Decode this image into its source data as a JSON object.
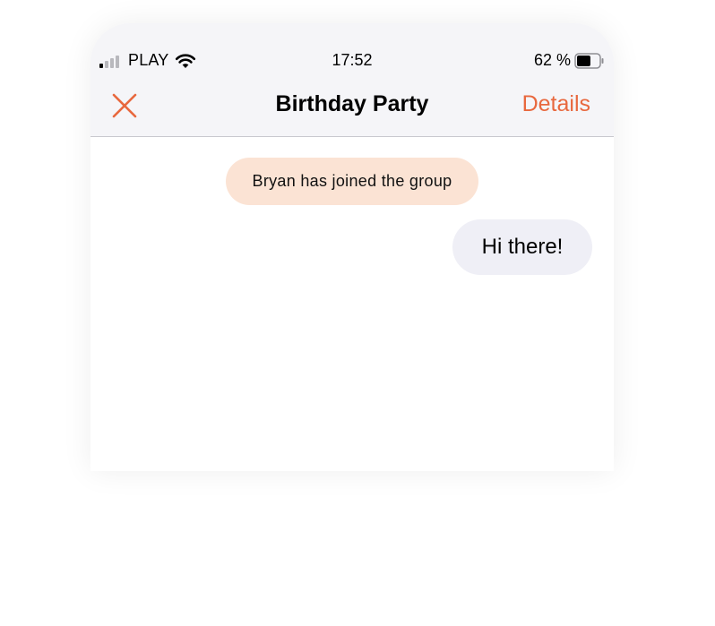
{
  "status_bar": {
    "carrier": "PLAY",
    "time": "17:52",
    "battery_percent": "62 %",
    "battery_level": 0.62,
    "signal_bars_active": 1,
    "signal_bars_total": 4,
    "signal_icon": "cellular-signal-icon",
    "wifi_icon": "wifi-icon",
    "battery_icon": "battery-icon"
  },
  "nav": {
    "close_icon": "close-icon",
    "title": "Birthday Party",
    "details_label": "Details"
  },
  "chat": {
    "system_message": "Bryan has joined the group",
    "messages": [
      {
        "text": "Hi there!",
        "outgoing": true
      }
    ]
  },
  "colors": {
    "accent": "#e8683e",
    "header_bg": "#f5f5f8",
    "system_bubble_bg": "#fbe3d4",
    "message_bubble_bg": "#efeff6"
  }
}
